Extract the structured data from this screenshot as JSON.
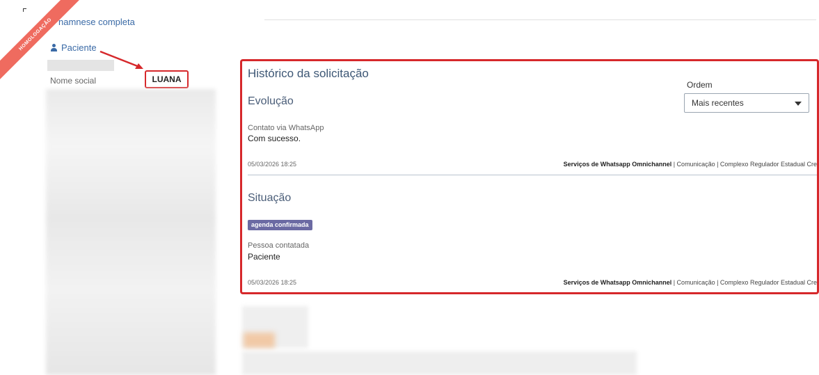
{
  "ribbon": {
    "text": "HOMOLOGAÇÃO"
  },
  "sidebar": {
    "anamnese_link": "namnese completa",
    "paciente_title": "Paciente",
    "nome_social_label": "Nome social",
    "nome_social_value": "LUANA"
  },
  "historico": {
    "title": "Histórico da solicitação",
    "ordem_label": "Ordem",
    "ordem_selected": "Mais recentes",
    "entries": [
      {
        "section_title": "Evolução",
        "field_label": "Contato via WhatsApp",
        "field_value": "Com sucesso.",
        "timestamp": "05/03/2026 18:25",
        "service_name": "Serviços de Whatsapp Omnichannel",
        "service_rest": " | Comunicação | Complexo Regulador Estadual Cre"
      },
      {
        "section_title": "Situação",
        "status_badge": "agenda confirmada",
        "field_label": "Pessoa contatada",
        "field_value": "Paciente",
        "timestamp": "05/03/2026 18:25",
        "service_name": "Serviços de Whatsapp Omnichannel",
        "service_rest": " | Comunicação | Complexo Regulador Estadual Cre"
      }
    ]
  },
  "colors": {
    "highlight_red": "#d6282b",
    "link_blue": "#3a6aa6",
    "badge_purple": "#6b6aa3",
    "ribbon_salmon": "#ef6b5f"
  },
  "icons": [
    "user-icon",
    "chevron-down-icon",
    "annotation-arrow"
  ]
}
